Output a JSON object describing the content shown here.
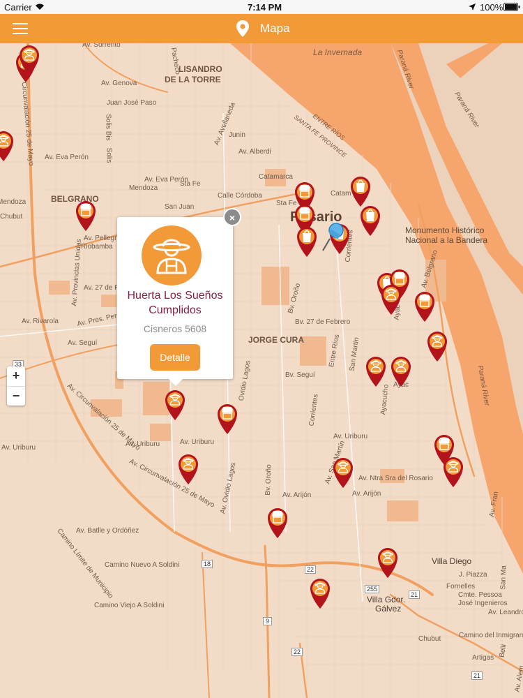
{
  "status_bar": {
    "carrier": "Carrier",
    "time": "7:14 PM",
    "battery": "100%"
  },
  "navbar": {
    "title": "Mapa",
    "menu_icon": "list-menu-icon",
    "title_icon": "map-pin-icon"
  },
  "map": {
    "labels": {
      "la_invernada": "La Invernada",
      "av_sorrento": "Av. Sorrento",
      "lisandro": "LISANDRO",
      "de_la_torre": "DE LA TORRE",
      "av_genova": "Av. Genova",
      "juan_jose_paso": "Juan José Paso",
      "av_avellaneda": "Av. Avellaneda",
      "junin": "Junin",
      "pacheco": "Pacheco",
      "solis_bis": "Solis Bis",
      "solis": "Solis",
      "entre_rios_prov": "ENTRE RÍOS",
      "santa_fe_prov": "SANTA FE PROVINCE",
      "av_eva_peron": "Av. Eva Perón",
      "av_eva_peron_2": "Av. Eva Perón",
      "av_alberdi": "Av. Alberdi",
      "catamarca": "Catamarca",
      "catam": "Catam",
      "sta_fe": "Sta Fe",
      "sta_fe_2": "Sta Fe",
      "calle_cordoba": "Calle Córdoba",
      "san_juan": "San Juan",
      "mendoza": "Mendoza",
      "mendoza_2": "Mendoza",
      "belgrano": "BELGRANO",
      "chubut_w": "Chubut",
      "av_pellegrini": "Av. Pellegrini",
      "riobamba": "Riobamba",
      "av_provincias_unidas": "Av. Provincias Unidas",
      "av_27_feb_w": "Av. 27 de Feb",
      "av_rivarola": "Av. Rivarola",
      "av_pres_peron": "Av. Pres. Perón",
      "av_segui_w": "Av. Seguí",
      "rosario": "Rosario",
      "monumento_1": "Monumento Histórico",
      "monumento_2": "Nacional a la Bandera",
      "bv_27_feb": "Bv. 27 de Febrero",
      "jorge_cura": "JORGE CURA",
      "bv_segui": "Bv. Seguí",
      "bv_orono_n": "Bv. Oroño",
      "corrientes_n": "Corrientes",
      "entre_rios": "Entre Ríos",
      "san_martin": "San Martín",
      "ayacucho": "Ayacucho",
      "ayac": "Ayac",
      "ayac_2": "Ayac",
      "av_belgrano": "Av. Belgrano",
      "parana_river": "Paraná River",
      "parana_river_2": "Paraná River",
      "parana_river_3": "Paraná River",
      "circunvalacion_n": "Circunvalación 25 de Mayo",
      "circunvalacion_s": "Av. Circunvalación 25 de Mayo",
      "circunvalacion_s2": "Av. Circunvalación 25 de Mayo",
      "av_uriburu_w": "Av. Uriburu",
      "av_uriburu_w2": "Av. Uriburu",
      "av_uriburu": "Av. Uriburu",
      "av_uriburu_2": "Av. Uriburu",
      "ovidio_lagos": "Ovidio Lagos",
      "av_ovidio_lagos": "Av. Ovidio Lagos",
      "bv_orono_s": "Bv. Oroño",
      "corrientes_s": "Corrientes",
      "av_san_martin": "Av. San Martín",
      "av_ntra_sra": "Av. Ntra Sra del Rosario",
      "av_arijon": "Av. Arijón",
      "av_arijon_2": "Av. Arijón",
      "av_batlle": "Av. Batlle y Ordóñez",
      "camino_limite": "Camino Límite de Municipio",
      "camino_nuevo": "Camino Nuevo A Soldini",
      "camino_viejo": "Camino Viejo A Soldini",
      "villa_diego": "Villa Diego",
      "j_piazza": "J. Piazza",
      "fornelles": "Fornelles",
      "cmte_pessoa": "Cmte. Pessoa",
      "jose_ingenieros": "José Ingenieros",
      "av_leandro": "Av. Leandro N. A",
      "villa_gdor_1": "Villa Gdor.",
      "villa_gdor_2": "Gálvez",
      "chubut_s": "Chubut",
      "camino_inmigrante": "Camino del Inmigrante",
      "artigas": "Artigas",
      "san_ma": "San Ma",
      "av_fran": "Av. Fran",
      "belli": "Belli",
      "av_alem": "Av. Alem"
    },
    "shields": {
      "s33": "33",
      "s18": "18",
      "s9": "9",
      "s22": "22",
      "s22b": "22",
      "s255": "255",
      "s21": "21",
      "s21b": "21"
    },
    "zoom": {
      "in": "+",
      "out": "−"
    }
  },
  "popup": {
    "name": "Huerta Los Sueños Cumplidos",
    "address": "Cisneros 5608",
    "button": "Detalle",
    "close": "×",
    "avatar_icon": "farmer-icon"
  },
  "colors": {
    "accent": "#f29a38",
    "marker": "#b3141c",
    "marker_icon": "#f29a38",
    "water": "#f6a56c",
    "popup_title": "#8b1e3f"
  }
}
